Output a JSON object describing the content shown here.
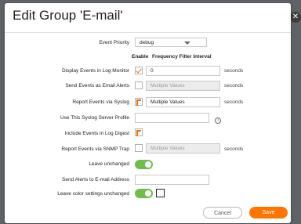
{
  "dialog": {
    "title": "Edit Group 'E-mail'",
    "close_symbol": "✕"
  },
  "columns": {
    "enable": "Enable",
    "frequency": "Frequency Filter Interval"
  },
  "event_priority": {
    "label": "Event Priority",
    "value": "debug"
  },
  "rows": {
    "display_events": {
      "label": "Display Events in Log Monitor",
      "value": "0",
      "unit": "seconds",
      "checked": true
    },
    "send_email": {
      "label": "Send Events as Email Alerts",
      "value": "Multiple Values",
      "unit": "seconds",
      "checked": false
    },
    "report_syslog": {
      "label": "Report Events via Syslog",
      "value": "Multiple Values",
      "unit": "seconds",
      "checked": true
    },
    "syslog_profile": {
      "label": "Use This Syslog Server Profile",
      "value": ""
    },
    "log_digest": {
      "label": "Include Events in Log Digest",
      "checked": true
    },
    "snmp_trap": {
      "label": "Report Events via SNMP Trap",
      "value": "Multiple Values",
      "unit": "seconds",
      "checked": false
    },
    "leave_unchanged": {
      "label": "Leave unchanged",
      "on": true
    },
    "send_alerts_email": {
      "label": "Send Alerts to E-mail Address",
      "value": ""
    },
    "leave_color": {
      "label": "Leave color settings unchanged",
      "on": true
    }
  },
  "buttons": {
    "cancel": "Cancel",
    "save": "Save"
  },
  "colors": {
    "accent": "#ff7500",
    "toggle_on": "#6cc04a"
  },
  "icons": {
    "info": "info-icon",
    "close": "close-icon",
    "dropdown": "chevron-down-icon"
  }
}
